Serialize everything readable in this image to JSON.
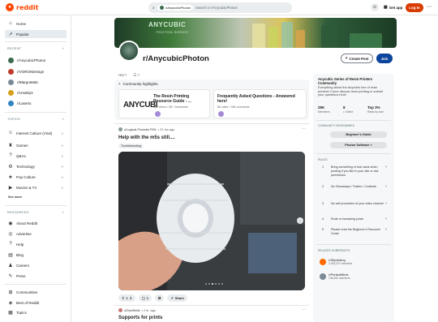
{
  "header": {
    "logo_text": "reddit",
    "search_chip": "r/AnycubicPhoton",
    "search_placeholder": "Search in r/AnycubicPhoton",
    "get_app": "Get app",
    "login": "Log In"
  },
  "sidebar": {
    "nav": [
      {
        "label": "Home",
        "icon": "home-icon"
      },
      {
        "label": "Popular",
        "icon": "popular-icon"
      }
    ],
    "recent_heading": "RECENT",
    "recent": [
      {
        "label": "r/AnycubicPhoton",
        "color": "#3b6b4e"
      },
      {
        "label": "r/VORONDesign",
        "color": "#c0392b"
      },
      {
        "label": "r/BlargoMatic",
        "color": "#7a8a96"
      },
      {
        "label": "r/creality3",
        "color": "#d4a017"
      },
      {
        "label": "r/Lasertx",
        "color": "#2e86c1"
      }
    ],
    "topics_heading": "TOPICS",
    "topics": [
      {
        "label": "Internet Culture (Viral)",
        "icon": "internet-icon"
      },
      {
        "label": "Games",
        "icon": "games-icon"
      },
      {
        "label": "Q&As",
        "icon": "qa-icon"
      },
      {
        "label": "Technology",
        "icon": "technology-icon"
      },
      {
        "label": "Pop Culture",
        "icon": "pop-culture-icon"
      },
      {
        "label": "Movies & TV",
        "icon": "movies-icon"
      }
    ],
    "see_more": "See more",
    "resources_heading": "RESOURCES",
    "resources": [
      {
        "label": "About Reddit",
        "icon": "about-icon"
      },
      {
        "label": "Advertise",
        "icon": "advertise-icon"
      },
      {
        "label": "Help",
        "icon": "help-icon"
      },
      {
        "label": "Blog",
        "icon": "blog-icon"
      },
      {
        "label": "Careers",
        "icon": "careers-icon"
      },
      {
        "label": "Press",
        "icon": "press-icon"
      }
    ],
    "bottom": [
      {
        "label": "Communities",
        "icon": "communities-icon"
      },
      {
        "label": "Best of Reddit",
        "icon": "best-of-icon"
      },
      {
        "label": "Topics",
        "icon": "topics-icon"
      }
    ]
  },
  "banner": {
    "title": "ANYCUBIC",
    "subtitle": "PHOTON SERIES"
  },
  "subreddit": {
    "name": "r/AnycubicPhoton",
    "create_post": "Create Post",
    "join": "Join"
  },
  "sort": {
    "label": "Hot",
    "view": "☰"
  },
  "highlights": {
    "title": "Community highlights",
    "cards": [
      {
        "title": "The Resin Printing Resource Guide - ...",
        "meta": "upd views • 28+ Comments",
        "logo": "ANYCUBI"
      },
      {
        "title": "Frequently Asked Questions - Answered here!",
        "meta": "All votes • 768 comments"
      }
    ]
  },
  "posts": [
    {
      "user": "u/Logical-Flounder7591",
      "time": "• 21 hrs ago",
      "title": "Help with the m5s still....",
      "flair": "Troubleshooting",
      "upvotes": "1",
      "comments": "1",
      "share": "Share"
    },
    {
      "user": "u/DaxiMolls",
      "time": "• 2 hr. ago",
      "title": "Supports for prints"
    }
  ],
  "about": {
    "title": "Anycubic Series of Resin Printers Community",
    "description": "Everything about the Anycubic line of resin printers! Come discuss resin printing or submit your questions here!",
    "members_value": "29K",
    "members_label": "Members",
    "online_value": "8",
    "online_label": "• Online",
    "rank_value": "Top 3%",
    "rank_label": "Rank by size"
  },
  "bookmarks": {
    "heading": "COMMUNITY BOOKMARKS",
    "items": [
      "Beginner's Guide",
      "Photon Software"
    ]
  },
  "rules": {
    "heading": "RULES",
    "items": [
      "Bring something of real value when posting if you like to your site or ask permission.",
      "No Giveaways / Trades / Contests",
      "No self promotion of your video channel",
      "Rude or harassing posts",
      "Please read the Beginner's Resource Guide"
    ]
  },
  "related": {
    "heading": "RELATED SUBREDDITS",
    "items": [
      {
        "name": "r/3Dprinting",
        "members": "2,515,237 members",
        "color": "#ff6a00"
      },
      {
        "name": "r/PrintedMinis",
        "members": "136,060 members",
        "color": "#7a8a96"
      }
    ]
  }
}
